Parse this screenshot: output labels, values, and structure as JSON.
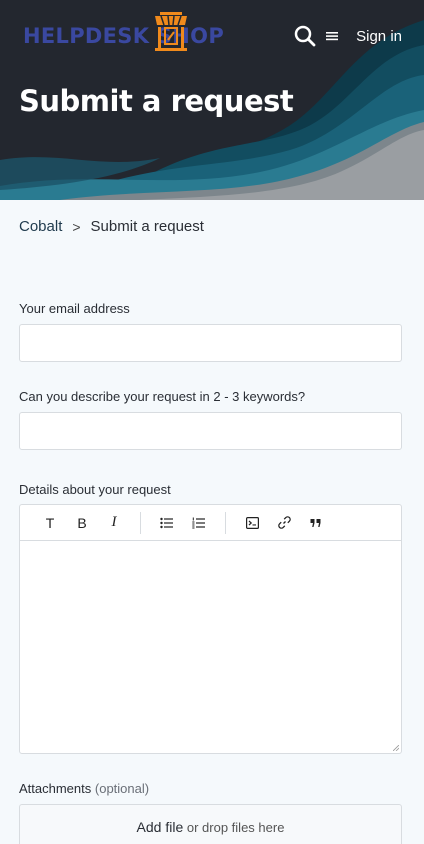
{
  "header": {
    "logo_text": "HELPDESK SHOP",
    "sign_in_label": "Sign in",
    "page_title": "Submit a request",
    "search_icon": "search-icon",
    "menu_icon": "hamburger-menu-icon"
  },
  "breadcrumb": {
    "items": [
      "Cobalt",
      "Submit a request"
    ],
    "separator": ">"
  },
  "form": {
    "email_label": "Your email address",
    "email_value": "",
    "keywords_label": "Can you describe your request in 2 - 3 keywords?",
    "keywords_value": "",
    "details_label": "Details about your request",
    "details_value": "",
    "toolbar": {
      "text_format_label": "T",
      "bold_label": "B",
      "italic_label": "I"
    },
    "attachments_label": "Attachments",
    "attachments_optional": "(optional)",
    "add_file_label": "Add file",
    "drop_files_label": "or drop files here"
  },
  "colors": {
    "header_dark": "#23272f",
    "teal_wave": "#1a5f74",
    "logo_blue": "#3a48a0",
    "logo_orange": "#f08a1c",
    "page_bg": "#f5f9fc"
  }
}
